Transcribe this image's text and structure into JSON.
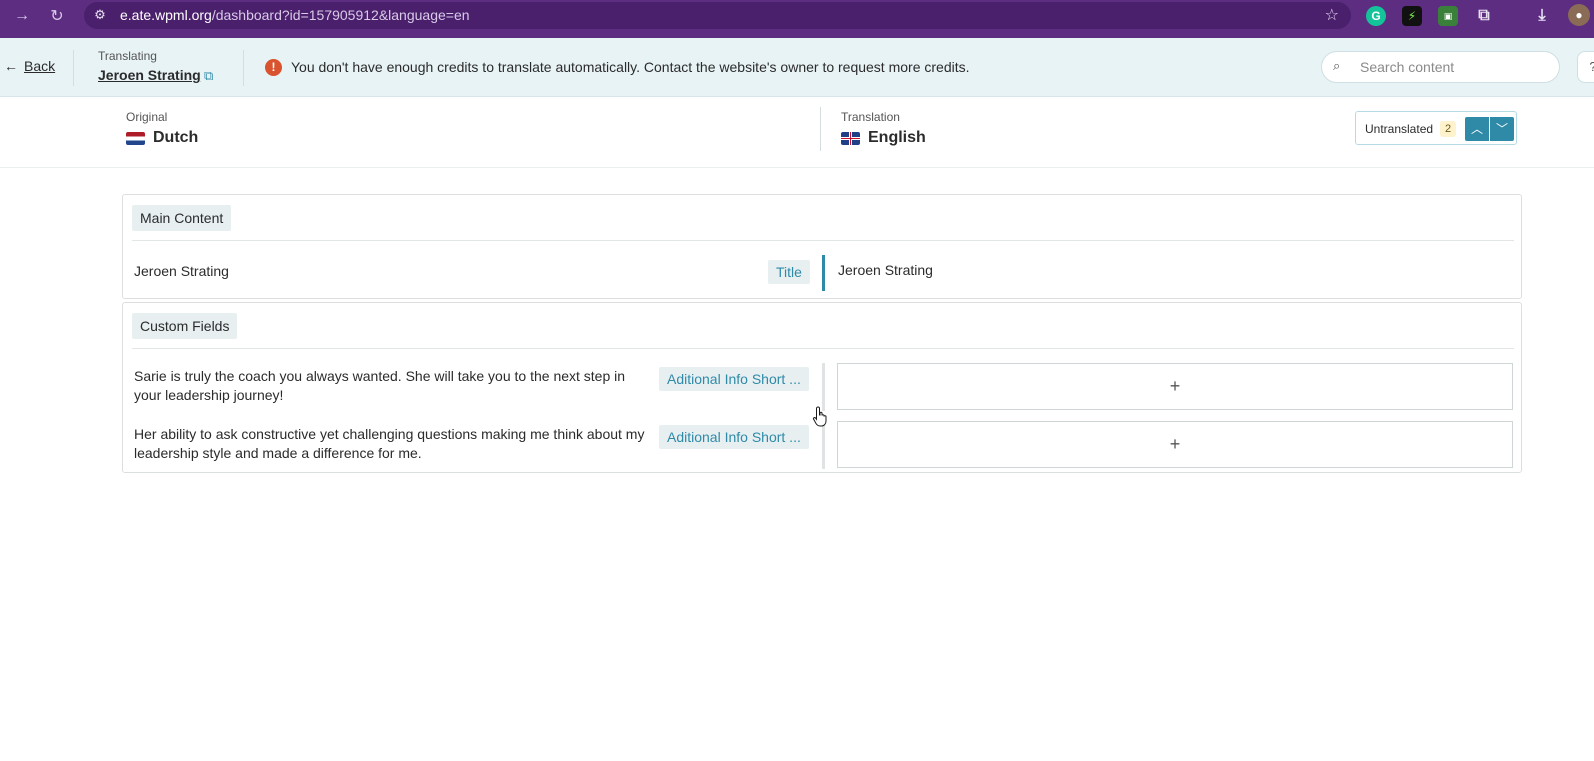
{
  "browser": {
    "url_host": "e.ate.wpml.org",
    "url_path": "/dashboard?id=157905912&language=en",
    "icons": [
      "forward-icon",
      "reload-icon",
      "site-settings-icon",
      "bookmark-star-icon",
      "grammarly-extension-icon",
      "extension-icon",
      "extension-icon-2",
      "extensions-puzzle-icon",
      "download-icon",
      "profile-avatar"
    ]
  },
  "header": {
    "back_label": "Back",
    "translating_label": "Translating",
    "translating_name": "Jeroen Strating",
    "alert_text": "You don't have enough credits to translate automatically. Contact the website's owner to request more credits.",
    "search_placeholder": "Search content"
  },
  "languages": {
    "original_label": "Original",
    "original_name": "Dutch",
    "translation_label": "Translation",
    "translation_name": "English",
    "filter_label": "Untranslated",
    "filter_count": "2"
  },
  "sections": {
    "main": {
      "title": "Main Content",
      "rows": [
        {
          "source": "Jeroen Strating",
          "field": "Title",
          "target": "Jeroen Strating"
        }
      ]
    },
    "custom": {
      "title": "Custom Fields",
      "rows": [
        {
          "source": "Sarie is truly the coach you always wanted. She will take you to the next step in your leadership journey!",
          "field": "Aditional Info Short ...",
          "target": "+"
        },
        {
          "source": "Her ability to ask constructive yet challenging questions making me think about my leadership style and made a difference for me.",
          "field": "Aditional Info Short ...",
          "target": "+"
        }
      ]
    }
  },
  "colors": {
    "browser_purple": "#5c2d80",
    "accent_teal": "#2f8aa8",
    "header_bg": "#e8f3f5",
    "alert_red": "#d8532e"
  }
}
